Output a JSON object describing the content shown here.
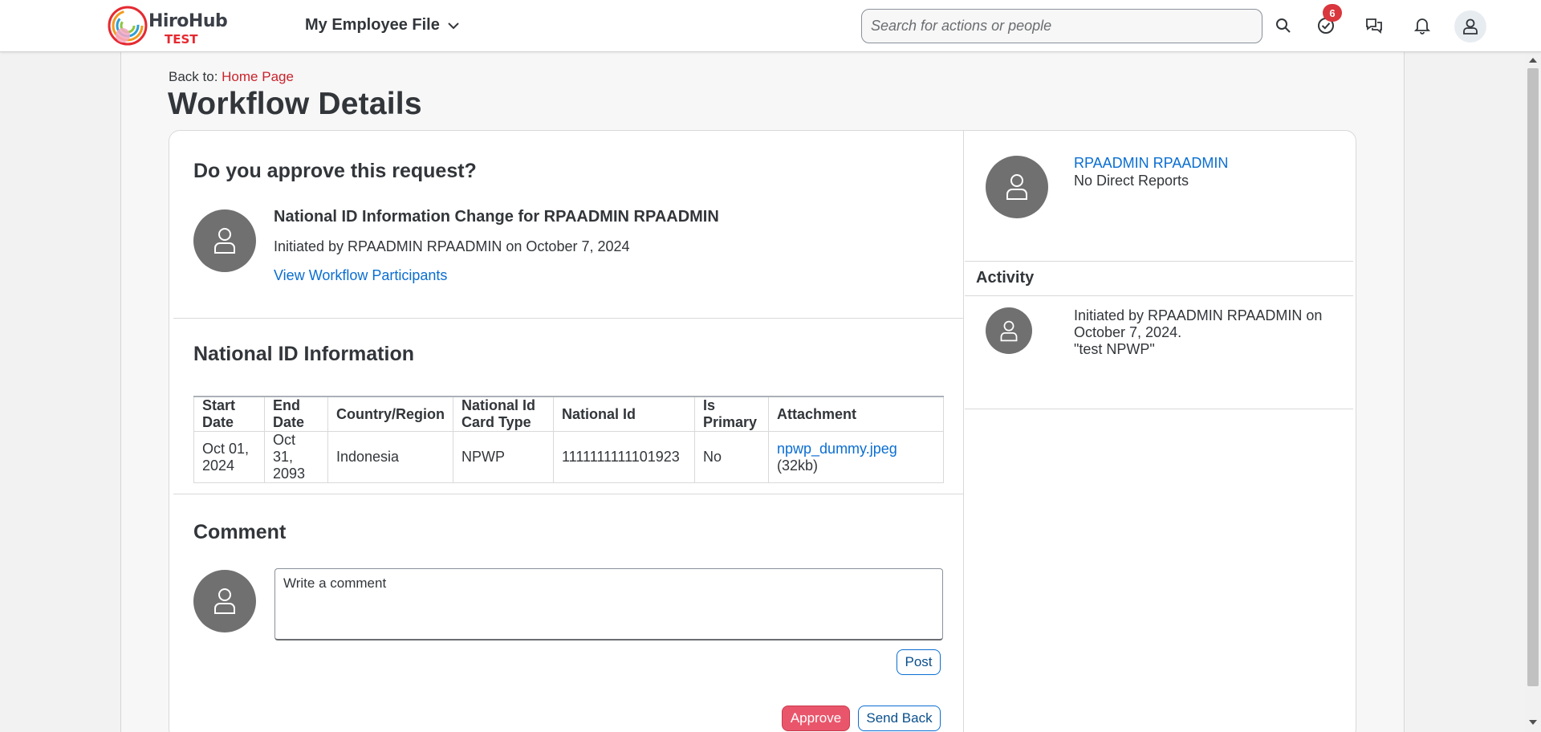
{
  "shell": {
    "logo_text": "HiroHub",
    "logo_sub": "TEST",
    "app_title": "My Employee File",
    "search_placeholder": "Search for actions or people",
    "todo_count": "6",
    "icons": [
      "search-icon",
      "task-check-icon",
      "feedback-icon",
      "bell-icon",
      "user-icon"
    ]
  },
  "page": {
    "back_prefix": "Back to:",
    "back_link": "Home Page",
    "title": "Workflow Details"
  },
  "request": {
    "heading": "Do you approve this request?",
    "title": "National ID Information Change for RPAADMIN RPAADMIN",
    "initiated": "Initiated by RPAADMIN RPAADMIN on October 7, 2024",
    "participants_link": "View Workflow Participants"
  },
  "national_id": {
    "heading": "National ID Information",
    "columns": {
      "start_date_1": "Start",
      "start_date_2": "Date",
      "end_date_1": "End",
      "end_date_2": "Date",
      "country": "Country/Region",
      "card_type_1": "National Id",
      "card_type_2": "Card Type",
      "national_id": "National Id",
      "is_primary_1": "Is",
      "is_primary_2": "Primary",
      "attachment": "Attachment"
    },
    "row": {
      "start_1": "Oct 01,",
      "start_2": "2024",
      "end_1": "Oct 31,",
      "end_2": "2093",
      "country": "Indonesia",
      "card_type": "NPWP",
      "national_id": "1111111111101923",
      "is_primary": "No",
      "attachment_name": "npwp_dummy.jpeg",
      "attachment_size": "(32kb)"
    }
  },
  "comment": {
    "heading": "Comment",
    "placeholder": "Write a comment",
    "post_label": "Post"
  },
  "actions": {
    "approve_label": "Approve",
    "send_back_label": "Send Back"
  },
  "sidebar": {
    "user_name": "RPAADMIN RPAADMIN",
    "user_sub": "No Direct Reports",
    "activity_heading": "Activity",
    "activity_line1": "Initiated by RPAADMIN RPAADMIN on",
    "activity_line2": "October 7, 2024.",
    "activity_line3": "\"test NPWP\""
  },
  "colors": {
    "brand_red": "#e52a31",
    "link_blue": "#0a6ed1",
    "approve": "#e9566b",
    "badge": "#d9363e",
    "avatar_gray": "#707070"
  }
}
